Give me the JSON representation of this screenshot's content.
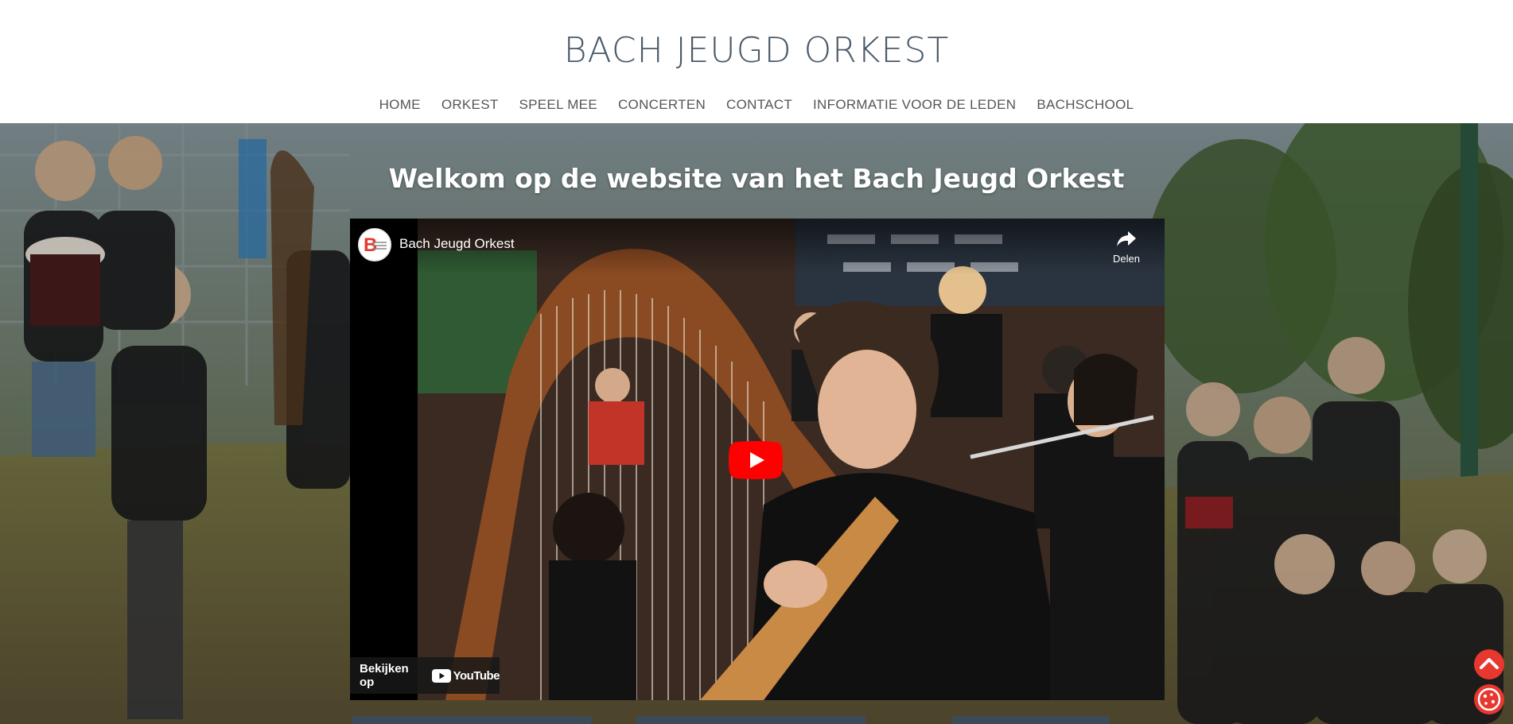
{
  "header": {
    "site_title": "BACH JEUGD ORKEST",
    "nav": [
      {
        "label": "HOME"
      },
      {
        "label": "ORKEST"
      },
      {
        "label": "SPEEL MEE"
      },
      {
        "label": "CONCERTEN"
      },
      {
        "label": "CONTACT"
      },
      {
        "label": "INFORMATIE VOOR DE LEDEN"
      },
      {
        "label": "BACHSCHOOL"
      }
    ]
  },
  "hero": {
    "heading": "Welkom op de website van het Bach Jeugd Orkest"
  },
  "video": {
    "title": "Bach Jeugd Orkest",
    "share_label": "Delen",
    "watch_on_label": "Bekijken op",
    "youtube_label": "YouTube",
    "icons": {
      "play": "play-icon",
      "share": "share-icon",
      "channel": "channel-logo"
    }
  },
  "floating_buttons": {
    "scroll_top_icon": "chevron-up-icon",
    "cookie_icon": "cookie-icon"
  },
  "colors": {
    "accent_red": "#e8372f",
    "nav_text": "#555555",
    "title_text": "#4a5a6a",
    "youtube_red": "#ff0000"
  }
}
